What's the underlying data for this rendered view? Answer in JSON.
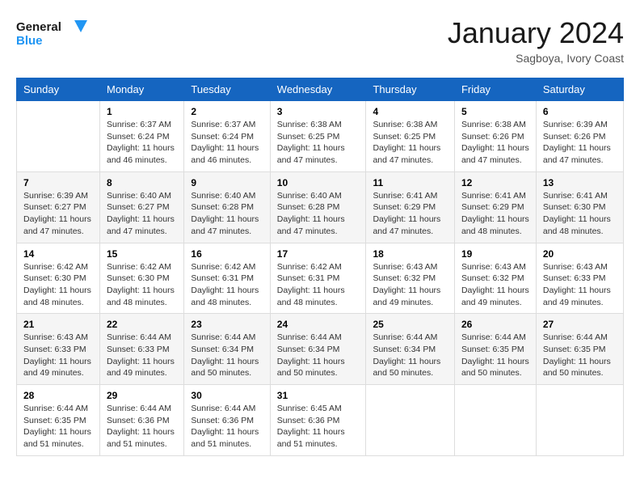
{
  "header": {
    "logo_line1": "General",
    "logo_line2": "Blue",
    "month": "January 2024",
    "location": "Sagboya, Ivory Coast"
  },
  "columns": [
    "Sunday",
    "Monday",
    "Tuesday",
    "Wednesday",
    "Thursday",
    "Friday",
    "Saturday"
  ],
  "weeks": [
    [
      {
        "day": "",
        "empty": true
      },
      {
        "day": "1",
        "sunrise": "6:37 AM",
        "sunset": "6:24 PM",
        "daylight": "11 hours and 46 minutes."
      },
      {
        "day": "2",
        "sunrise": "6:37 AM",
        "sunset": "6:24 PM",
        "daylight": "11 hours and 46 minutes."
      },
      {
        "day": "3",
        "sunrise": "6:38 AM",
        "sunset": "6:25 PM",
        "daylight": "11 hours and 47 minutes."
      },
      {
        "day": "4",
        "sunrise": "6:38 AM",
        "sunset": "6:25 PM",
        "daylight": "11 hours and 47 minutes."
      },
      {
        "day": "5",
        "sunrise": "6:38 AM",
        "sunset": "6:26 PM",
        "daylight": "11 hours and 47 minutes."
      },
      {
        "day": "6",
        "sunrise": "6:39 AM",
        "sunset": "6:26 PM",
        "daylight": "11 hours and 47 minutes."
      }
    ],
    [
      {
        "day": "7",
        "sunrise": "6:39 AM",
        "sunset": "6:27 PM",
        "daylight": "11 hours and 47 minutes."
      },
      {
        "day": "8",
        "sunrise": "6:40 AM",
        "sunset": "6:27 PM",
        "daylight": "11 hours and 47 minutes."
      },
      {
        "day": "9",
        "sunrise": "6:40 AM",
        "sunset": "6:28 PM",
        "daylight": "11 hours and 47 minutes."
      },
      {
        "day": "10",
        "sunrise": "6:40 AM",
        "sunset": "6:28 PM",
        "daylight": "11 hours and 47 minutes."
      },
      {
        "day": "11",
        "sunrise": "6:41 AM",
        "sunset": "6:29 PM",
        "daylight": "11 hours and 47 minutes."
      },
      {
        "day": "12",
        "sunrise": "6:41 AM",
        "sunset": "6:29 PM",
        "daylight": "11 hours and 48 minutes."
      },
      {
        "day": "13",
        "sunrise": "6:41 AM",
        "sunset": "6:30 PM",
        "daylight": "11 hours and 48 minutes."
      }
    ],
    [
      {
        "day": "14",
        "sunrise": "6:42 AM",
        "sunset": "6:30 PM",
        "daylight": "11 hours and 48 minutes."
      },
      {
        "day": "15",
        "sunrise": "6:42 AM",
        "sunset": "6:30 PM",
        "daylight": "11 hours and 48 minutes."
      },
      {
        "day": "16",
        "sunrise": "6:42 AM",
        "sunset": "6:31 PM",
        "daylight": "11 hours and 48 minutes."
      },
      {
        "day": "17",
        "sunrise": "6:42 AM",
        "sunset": "6:31 PM",
        "daylight": "11 hours and 48 minutes."
      },
      {
        "day": "18",
        "sunrise": "6:43 AM",
        "sunset": "6:32 PM",
        "daylight": "11 hours and 49 minutes."
      },
      {
        "day": "19",
        "sunrise": "6:43 AM",
        "sunset": "6:32 PM",
        "daylight": "11 hours and 49 minutes."
      },
      {
        "day": "20",
        "sunrise": "6:43 AM",
        "sunset": "6:33 PM",
        "daylight": "11 hours and 49 minutes."
      }
    ],
    [
      {
        "day": "21",
        "sunrise": "6:43 AM",
        "sunset": "6:33 PM",
        "daylight": "11 hours and 49 minutes."
      },
      {
        "day": "22",
        "sunrise": "6:44 AM",
        "sunset": "6:33 PM",
        "daylight": "11 hours and 49 minutes."
      },
      {
        "day": "23",
        "sunrise": "6:44 AM",
        "sunset": "6:34 PM",
        "daylight": "11 hours and 50 minutes."
      },
      {
        "day": "24",
        "sunrise": "6:44 AM",
        "sunset": "6:34 PM",
        "daylight": "11 hours and 50 minutes."
      },
      {
        "day": "25",
        "sunrise": "6:44 AM",
        "sunset": "6:34 PM",
        "daylight": "11 hours and 50 minutes."
      },
      {
        "day": "26",
        "sunrise": "6:44 AM",
        "sunset": "6:35 PM",
        "daylight": "11 hours and 50 minutes."
      },
      {
        "day": "27",
        "sunrise": "6:44 AM",
        "sunset": "6:35 PM",
        "daylight": "11 hours and 50 minutes."
      }
    ],
    [
      {
        "day": "28",
        "sunrise": "6:44 AM",
        "sunset": "6:35 PM",
        "daylight": "11 hours and 51 minutes."
      },
      {
        "day": "29",
        "sunrise": "6:44 AM",
        "sunset": "6:36 PM",
        "daylight": "11 hours and 51 minutes."
      },
      {
        "day": "30",
        "sunrise": "6:44 AM",
        "sunset": "6:36 PM",
        "daylight": "11 hours and 51 minutes."
      },
      {
        "day": "31",
        "sunrise": "6:45 AM",
        "sunset": "6:36 PM",
        "daylight": "11 hours and 51 minutes."
      },
      {
        "day": "",
        "empty": true
      },
      {
        "day": "",
        "empty": true
      },
      {
        "day": "",
        "empty": true
      }
    ]
  ],
  "labels": {
    "sunrise": "Sunrise:",
    "sunset": "Sunset:",
    "daylight": "Daylight:"
  }
}
